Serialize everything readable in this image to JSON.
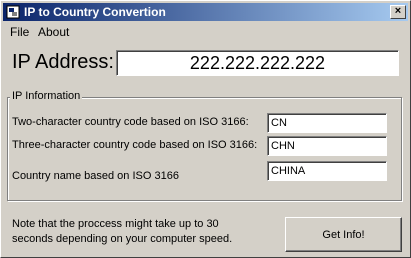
{
  "window": {
    "title": "IP to Country Convertion",
    "close_glyph": "×"
  },
  "menu": {
    "file": "File",
    "about": "About"
  },
  "ip": {
    "label": "IP Address:",
    "value": "222.222.222.222"
  },
  "group": {
    "legend": "IP Information",
    "rows": [
      {
        "label": "Two-character country code based on ISO 3166:",
        "value": "CN"
      },
      {
        "label": "Three-character country code based on ISO 3166:",
        "value": "CHN"
      },
      {
        "label": "Country name based on ISO 3166",
        "value": "CHINA"
      }
    ]
  },
  "note": "Note that the proccess might take up to 30 seconds depending on your computer speed.",
  "button": {
    "get_info": "Get Info!"
  },
  "colors": {
    "titlebar_start": "#0a246a",
    "titlebar_end": "#a6caf0",
    "face": "#d4d0c8"
  }
}
